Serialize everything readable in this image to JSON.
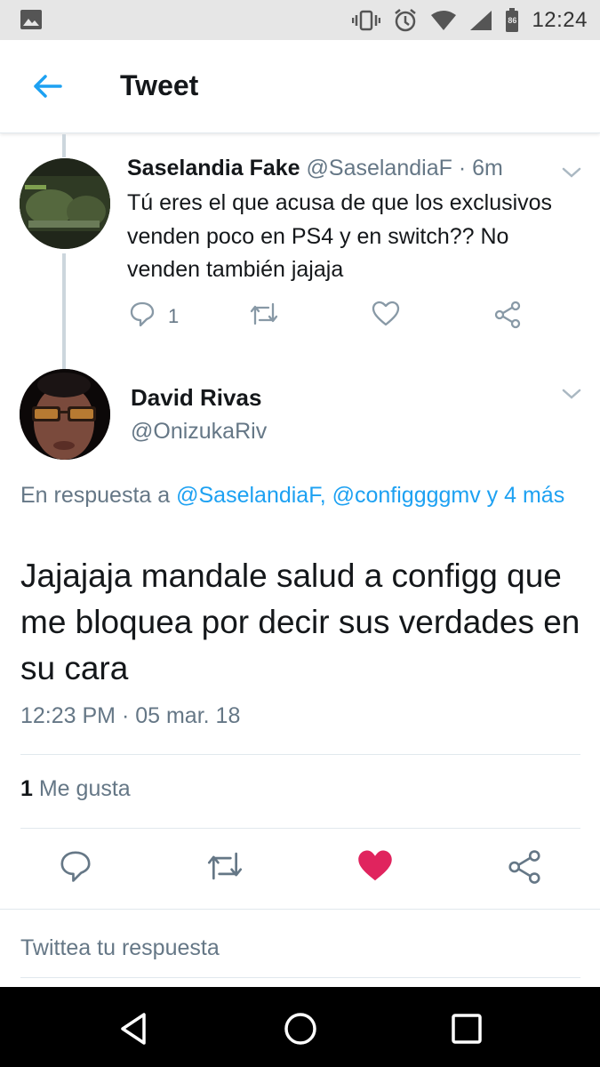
{
  "status_bar": {
    "time": "12:24",
    "battery_level": "86",
    "icons": [
      "image-icon",
      "vibrate-icon",
      "alarm-icon",
      "wifi-icon",
      "signal-icon",
      "battery-icon"
    ]
  },
  "header": {
    "title": "Tweet",
    "back_icon": "arrow-left-icon"
  },
  "parent_tweet": {
    "name": "Saselandia Fake",
    "handle": "@SaselandiaF",
    "separator": "·",
    "age": "6m",
    "text": "Tú eres el que acusa de que los exclusivos venden poco en PS4 y en switch?? No venden también jajaja",
    "reply_count": "1",
    "actions": [
      "reply-icon",
      "retweet-icon",
      "like-icon",
      "share-icon"
    ]
  },
  "main_tweet": {
    "name": "David Rivas",
    "handle": "@OnizukaRiv",
    "reply_prefix": "En respuesta a ",
    "reply_mentions": "@SaselandiaF, @configgggmv y 4 más",
    "text": "Jajajaja mandale salud a configg que me bloquea por decir sus verdades en su cara",
    "timestamp": "12:23 PM · 05 mar. 18",
    "likes_count": "1",
    "likes_label": "Me gusta",
    "liked": true,
    "like_color": "#e0245e",
    "actions": [
      "reply-icon",
      "retweet-icon",
      "like-filled-icon",
      "share-icon"
    ]
  },
  "reply_input": {
    "placeholder": "Twittea tu respuesta"
  },
  "colors": {
    "accent": "#1da1f2",
    "secondary_text": "#657786",
    "primary_text": "#14171a"
  },
  "nav_bar": {
    "buttons": [
      "back-triangle-icon",
      "home-circle-icon",
      "recents-square-icon"
    ]
  }
}
